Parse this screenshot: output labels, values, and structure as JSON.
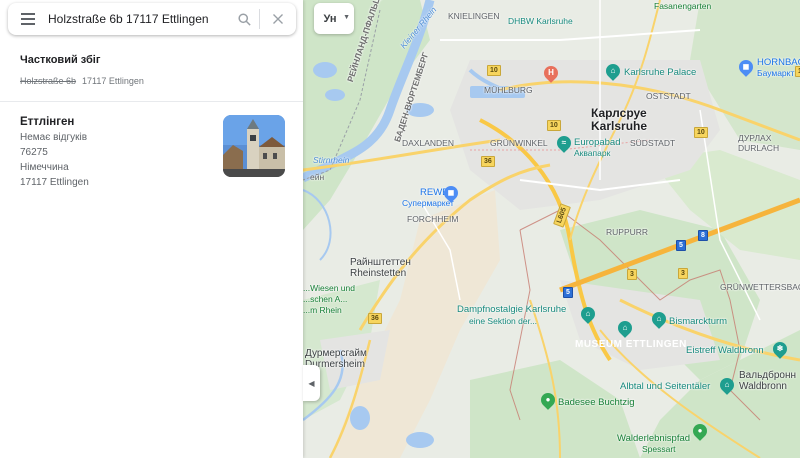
{
  "search": {
    "value": "Holzstraße 6b 17117 Ettlingen",
    "placeholder": ""
  },
  "partial_match": {
    "heading": "Частковий збіг",
    "struck": "Holzstraße 6b",
    "rest": "17117 Ettlingen"
  },
  "place": {
    "name": "Еттлінген",
    "reviews": "Немає відгуків",
    "postal": "76275",
    "country": "Німеччина",
    "address": "17117 Ettlingen"
  },
  "controls": {
    "layers_label": "Ун",
    "collapse_glyph": "◀"
  },
  "map": {
    "labels": {
      "knielingen": "KNIELINGEN",
      "dhbw": "DHBW Karlsruhe",
      "muhlburg": "MÜHLBURG",
      "karlsruhe_uk": "Карлсруе",
      "karlsruhe": "Karlsruhe",
      "palace": "Karlsruhe Palace",
      "oststadt": "OSTSTADT",
      "hornbach": "HORNBAC",
      "hornbach_sub": "Баумаркт",
      "durlach_uk": "ДУРЛАХ",
      "durlach": "DURLACH",
      "sudstadt": "SÜDSTADT",
      "grunwinkel": "GRÜNWINKEL",
      "europabad": "Europabad",
      "europabad_sub": "Аквапарк",
      "daxlanden": "DAXLANDEN",
      "rewe": "REWE",
      "rewe_sub": "Супермаркет",
      "forchheim": "FORCHHEIM",
      "ruppurr": "RUPPURR",
      "rheinstetten_uk": "Райнштеттен",
      "rheinstetten": "Rheinstetten",
      "wettersbach": "GRÜNWETTERSBACH",
      "dampf": "Dampfnostalgie Karlsruhe",
      "dampf_sub": "eine Sektion der...",
      "bismarck": "Bismarckturm",
      "museum": "MUSEUM ETTLINGEN",
      "eistreff": "Eistreff Waldbronn",
      "waldbronn_uk": "Вальдбронн",
      "waldbronn": "Waldbronn",
      "durmersheim_uk": "Дурмерсгайм",
      "durmersheim": "Durmersheim",
      "albtal": "Albtal und Seitentäler",
      "badesee": "Badesee Buchtzig",
      "walderlebnis": "Walderlebnispfad",
      "spessart": "Spessart",
      "rheinland": "РЕЙНЛАНД-ПФАЛЬЦ",
      "baden": "БАДЕН-ВЮРТЕМБЕРГ",
      "stirn": "Stirnrhein",
      "fasanengarten": "Fasanengarten",
      "kleiner_rhein": "Kleiner Rhein",
      "rhein_fragment": "ейн",
      "wiesen_1": "...Wiesen und",
      "wiesen_2": "...schen A...",
      "wiesen_3": "...m Rhein"
    },
    "shields": {
      "s10a": "10",
      "s10b": "10",
      "s10c": "10",
      "s10d": "10",
      "s36a": "36",
      "s36b": "36",
      "s3": "3",
      "s5": "5",
      "s5b": "5",
      "s8": "8",
      "l605": "L605",
      "s3b": "3"
    }
  }
}
